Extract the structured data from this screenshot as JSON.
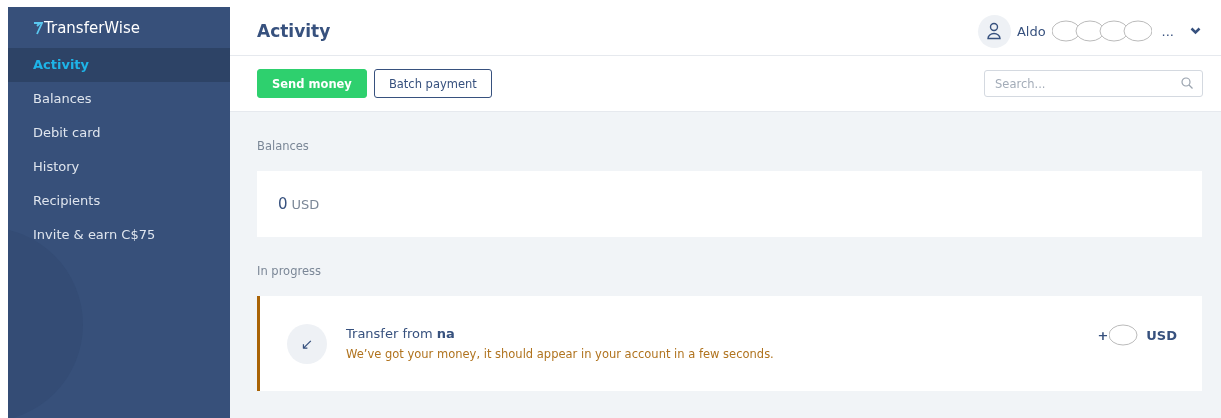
{
  "logo": {
    "text": "TransferWise"
  },
  "sidebar": {
    "items": [
      {
        "label": "Activity",
        "selected": true
      },
      {
        "label": "Balances",
        "selected": false
      },
      {
        "label": "Debit card",
        "selected": false
      },
      {
        "label": "History",
        "selected": false
      },
      {
        "label": "Recipients",
        "selected": false
      },
      {
        "label": "Invite & earn C$75",
        "selected": false
      }
    ]
  },
  "header": {
    "title": "Activity",
    "user": {
      "name": "Aldo",
      "ellipsis": "..."
    }
  },
  "toolbar": {
    "buttons": [
      {
        "label": "Send money",
        "kind": "primary"
      },
      {
        "label": "Batch payment",
        "kind": "secondary"
      }
    ],
    "search": {
      "placeholder": "Search..."
    }
  },
  "balances": {
    "heading": "Balances",
    "amount": "0",
    "currency": "USD"
  },
  "in_progress": {
    "heading": "In progress",
    "transfers": [
      {
        "icon": "↙",
        "title": "Transfer from **na**",
        "status": "We’ve got your money, it should appear in your account in a few seconds.",
        "sign": "+",
        "currency": "USD"
      }
    ]
  }
}
